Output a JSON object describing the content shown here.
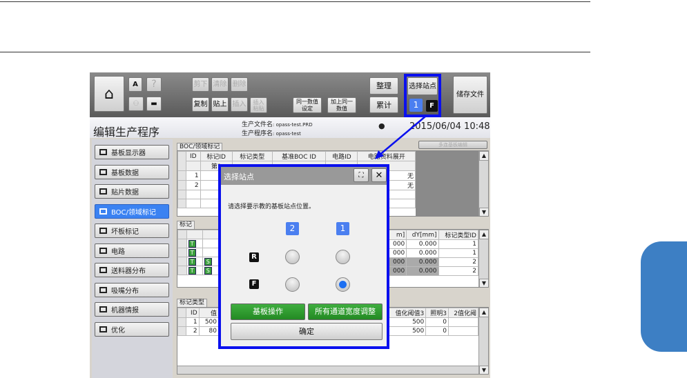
{
  "toolbar": {
    "cut": "剪下",
    "clear": "清除",
    "delete": "删除",
    "copy": "复制",
    "paste": "贴上",
    "insert": "插入",
    "insert_paste": "插入\n粘贴",
    "same_value": "同一数值\n设定",
    "add_same": "加上同一\n数值",
    "organize": "整理",
    "accumulate": "累计",
    "select_station": "选择站点",
    "station_num": "1",
    "station_side": "F",
    "save": "储存文件"
  },
  "header": {
    "title": "编辑生产程序",
    "file_label": "生产文件名",
    "file_value": ": opass-test.PRD",
    "prog_label": "生产程序名",
    "prog_value": ": opass-test",
    "datetime": "2015/06/04 10:48"
  },
  "sidebar": {
    "items": [
      {
        "label": "基板显示器"
      },
      {
        "label": "基板数据"
      },
      {
        "label": "贴片数据"
      },
      {
        "label": "BOC/领域标记",
        "active": true
      },
      {
        "label": "坏板标记"
      },
      {
        "label": "电路"
      },
      {
        "label": "送料器分布"
      },
      {
        "label": "吸嘴分布"
      },
      {
        "label": "机器情报"
      },
      {
        "label": "优化"
      }
    ]
  },
  "boc": {
    "tab": "BOC/领域标记",
    "multi_btn": "多连基板编辑",
    "headers": [
      "ID",
      "标记ID",
      "标记类型",
      "基准BOC ID",
      "电路ID",
      "电路资料展开"
    ],
    "sub": "第1",
    "rows": [
      {
        "id": "1",
        "expand": "无"
      },
      {
        "id": "2",
        "expand": "无"
      }
    ]
  },
  "marks": {
    "tab": "标记",
    "headers": [
      "m]",
      "dY[mm]",
      "标记类型ID"
    ],
    "rows": [
      {
        "t": "T",
        "s": "",
        "x": "000",
        "dy": "0.000",
        "type": "1"
      },
      {
        "t": "T",
        "s": "",
        "x": "000",
        "dy": "0.000",
        "type": "1"
      },
      {
        "t": "T",
        "s": "S",
        "x": "000",
        "dy": "0.000",
        "type": "2"
      },
      {
        "t": "T",
        "s": "S",
        "x": "000",
        "dy": "0.000",
        "type": "2"
      }
    ]
  },
  "marktype": {
    "tab": "标记类型",
    "headers": [
      "ID",
      "值",
      "值化阈值3",
      "照明3",
      "2值化阈"
    ],
    "rows": [
      {
        "id": "1",
        "val": "500",
        "th": "500",
        "light": "0"
      },
      {
        "id": "2",
        "val": "80",
        "th": "500",
        "light": "0"
      }
    ]
  },
  "dialog": {
    "title": "选择站点",
    "message": "请选择要示教的基板站点位置。",
    "col2": "2",
    "col1": "1",
    "row_r": "R",
    "row_f": "F",
    "selected": "F-1",
    "board_op": "基板操作",
    "all_width": "所有通道宽度调整",
    "ok": "确定"
  },
  "colors": {
    "accent": "#3b82f2",
    "highlight": "#0a10ee",
    "green": "#2e9b2e",
    "side_tab": "#3d7fc4"
  }
}
